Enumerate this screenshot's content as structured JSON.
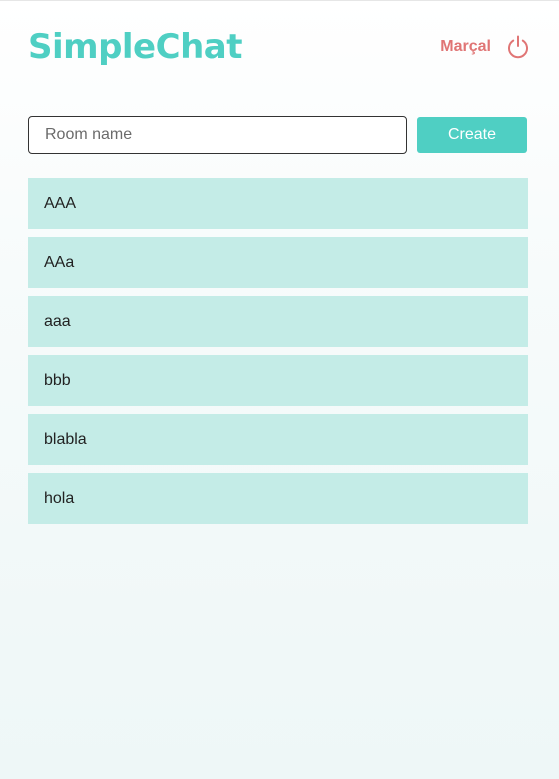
{
  "header": {
    "title": "SimpleChat",
    "username": "Marçal",
    "logout_icon": "power-icon"
  },
  "create": {
    "placeholder": "Room name",
    "value": "",
    "button_label": "Create"
  },
  "rooms": [
    {
      "name": "AAA"
    },
    {
      "name": "AAa"
    },
    {
      "name": "aaa"
    },
    {
      "name": "bbb"
    },
    {
      "name": "blabla"
    },
    {
      "name": "hola"
    }
  ],
  "colors": {
    "accent": "#4fcfc3",
    "room_background": "#c4ece7",
    "username": "#e07575"
  }
}
